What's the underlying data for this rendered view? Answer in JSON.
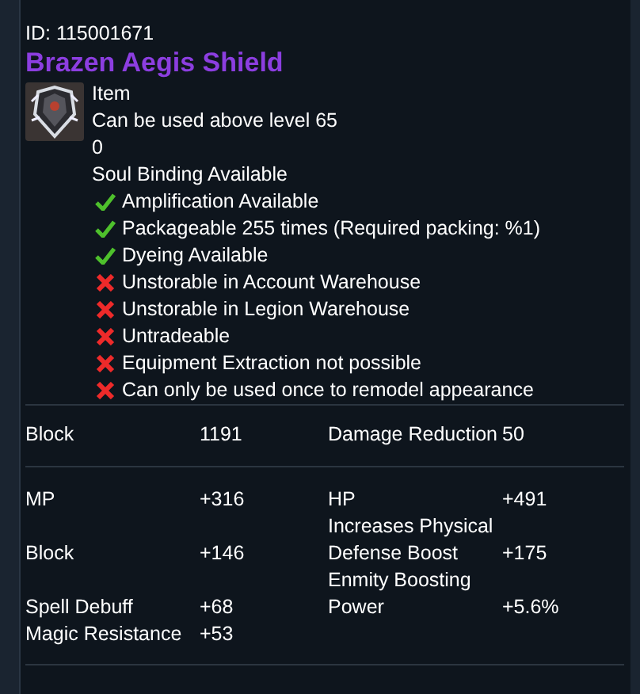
{
  "item_id": "ID: 115001671",
  "name": "Brazen Aegis Shield",
  "info": [
    "Item",
    "Can be used above level 65",
    "0",
    "Soul Binding Available"
  ],
  "properties": [
    {
      "kind": "allowed",
      "text": "Amplification Available"
    },
    {
      "kind": "allowed",
      "text": "Packageable 255 times (Required packing: %1)"
    },
    {
      "kind": "allowed",
      "text": "Dyeing Available"
    },
    {
      "kind": "denied",
      "text": "Unstorable in Account Warehouse"
    },
    {
      "kind": "denied",
      "text": "Unstorable in Legion Warehouse"
    },
    {
      "kind": "denied",
      "text": "Untradeable"
    },
    {
      "kind": "denied",
      "text": "Equipment Extraction not possible"
    },
    {
      "kind": "denied",
      "text": "Can only be used once to remodel appearance"
    }
  ],
  "base_stats": [
    {
      "left": {
        "label": "Block",
        "value": "1191"
      },
      "right": {
        "label": "Damage Reduction",
        "value": "50"
      }
    }
  ],
  "bonus_stats": [
    {
      "left": {
        "label": "MP",
        "value": "+316"
      },
      "right": {
        "label": "HP",
        "value": "+491"
      }
    },
    {
      "left": {
        "label": "Block",
        "value": "+146"
      },
      "right": {
        "label": "Increases Physical Defense Boost",
        "value": "+175"
      }
    },
    {
      "left": {
        "label": "Spell Debuff",
        "value": "+68"
      },
      "right": {
        "label": "Enmity Boosting Power",
        "value": "+5.6%"
      }
    },
    {
      "left": {
        "label": "Magic Resistance",
        "value": "+53"
      }
    }
  ]
}
